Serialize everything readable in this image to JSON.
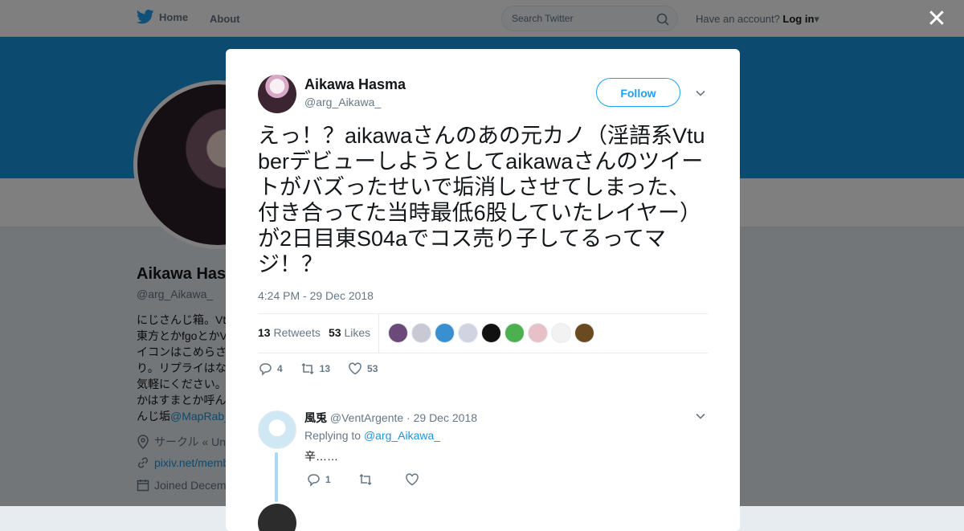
{
  "topnav": {
    "home_label": "Home",
    "about_label": "About",
    "search_placeholder": "Search Twitter",
    "have_account_label": "Have an account?",
    "login_label": "Log in"
  },
  "profile": {
    "name": "Aikawa Has",
    "handle": "@arg_Aikawa_",
    "bio_lines": [
      "にじさんじ箱。Vt",
      "東方とかfgoとかV",
      "イコンはこめらさ",
      "り。リプライはな",
      "気軽にください。",
      "かはすまとか呼ん"
    ],
    "bio_last_prefix": "んじ垢",
    "bio_link": "@MapRab_",
    "location": "サークル « Un",
    "website": "pixiv.net/memb",
    "joined": "Joined Decem"
  },
  "modal": {
    "close_label": "✕",
    "author_name": "Aikawa Hasma",
    "author_handle": "@arg_Aikawa_",
    "follow_label": "Follow",
    "tweet_text": "えっ！？aikawaさんのあの元カノ（淫語系Vtuberデビューしようとしてaikawaさんのツイートがバズったせいで垢消しさせてしまった、付き合ってた当時最低6股していたレイヤー）が2日目東S04aでコス売り子してるってマジ！？",
    "timestamp": "4:24 PM - 29 Dec 2018",
    "retweets_count": "13",
    "retweets_label": "Retweets",
    "likes_count": "53",
    "likes_label": "Likes",
    "liker_colors": [
      "#6b4a7a",
      "#c9c9d6",
      "#3a8fd0",
      "#d0d4e0",
      "#111111",
      "#4caf50",
      "#e8c0c8",
      "#f2f2f2",
      "#6a4a20"
    ],
    "actions": {
      "reply_count": "4",
      "retweet_count": "13",
      "like_count": "53"
    },
    "reply": {
      "name": "風兎",
      "handle": "@VentArgente",
      "date": "· 29 Dec 2018",
      "replying_to_label": "Replying to",
      "replying_to_handle": "@arg_Aikawa_",
      "text": "辛……",
      "reply_count": "1",
      "retweet_count": "",
      "like_count": ""
    }
  }
}
